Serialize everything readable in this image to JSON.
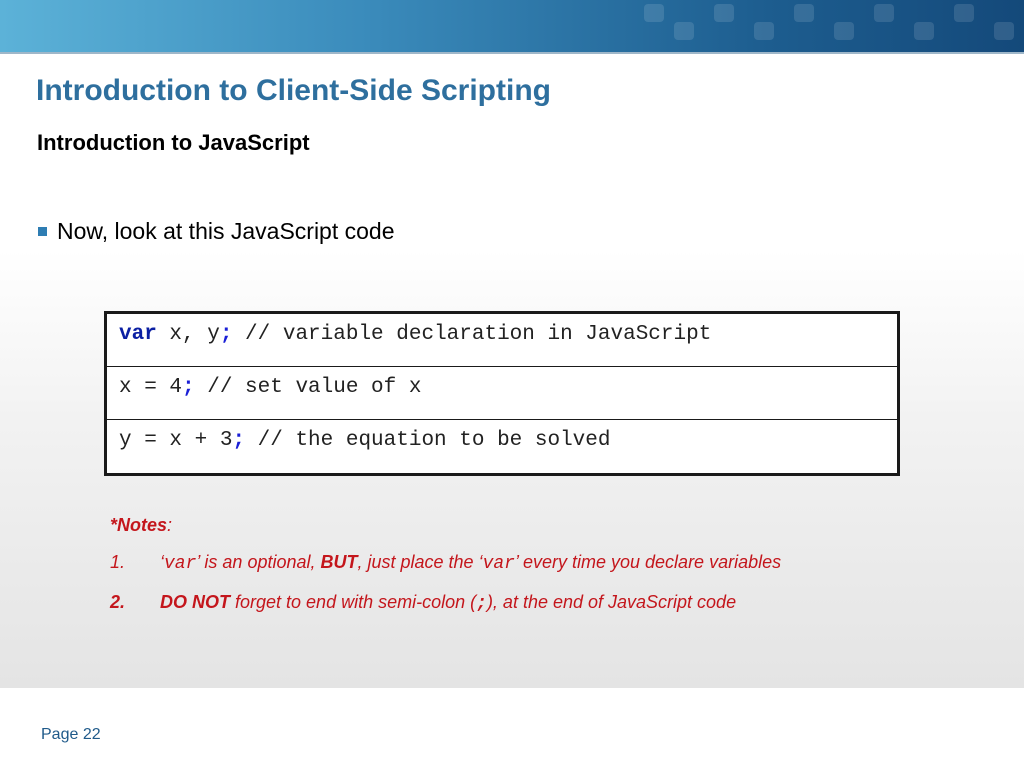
{
  "slide": {
    "title": "Introduction to Client-Side Scripting",
    "subtitle": "Introduction to JavaScript",
    "bullet": "Now, look at this JavaScript code"
  },
  "code": {
    "rows": [
      {
        "keyword": "var",
        "code": " x, y",
        "semicolon": ";",
        "comment": " // variable declaration in JavaScript"
      },
      {
        "keyword": "",
        "code": "x = 4",
        "semicolon": ";",
        "comment": " // set value of x"
      },
      {
        "keyword": "",
        "code": "y = x + 3",
        "semicolon": ";",
        "comment": " // the equation to be solved"
      }
    ]
  },
  "notes": {
    "title": "*Notes",
    "title_colon": ":",
    "items": [
      {
        "number": "1.",
        "q1_open": "‘",
        "code1": "var",
        "q1_close": "’",
        "text1": " is an optional, ",
        "emphasis": "BUT",
        "text2": ", just place the ‘",
        "code2": "var",
        "text3": "’ every time you declare variables"
      },
      {
        "number": "2.",
        "emphasis": "DO NOT",
        "text1": " forget to end with semi-colon (",
        "code": ";",
        "text2": "), at the end of JavaScript code"
      }
    ]
  },
  "footer": {
    "page_label": "Page 22"
  },
  "colors": {
    "title": "#2e6f9e",
    "banner": "#1d5d8f",
    "notes": "#c4161c",
    "keyword": "#0b1fa3"
  }
}
